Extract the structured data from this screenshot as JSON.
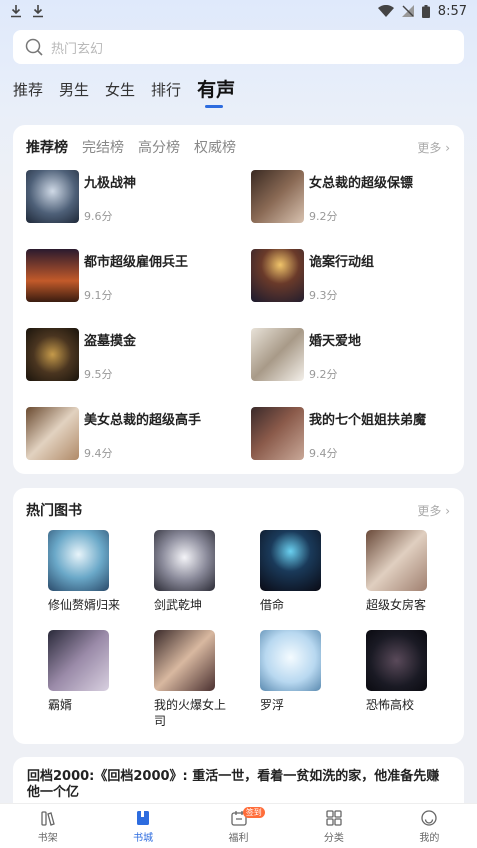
{
  "status_bar": {
    "time": "8:57"
  },
  "search": {
    "placeholder": "热门玄幻"
  },
  "nav_tabs": [
    "推荐",
    "男生",
    "女生",
    "排行",
    "有声"
  ],
  "ranking": {
    "tabs": [
      "推荐榜",
      "完结榜",
      "高分榜",
      "权威榜"
    ],
    "more": "更多",
    "items": [
      {
        "title": "九极战神",
        "score": "9.6分"
      },
      {
        "title": "女总裁的超级保镖",
        "score": "9.2分"
      },
      {
        "title": "都市超级雇佣兵王",
        "score": "9.1分"
      },
      {
        "title": "诡案行动组",
        "score": "9.3分"
      },
      {
        "title": "盗墓摸金",
        "score": "9.5分"
      },
      {
        "title": "婚天爱地",
        "score": "9.2分"
      },
      {
        "title": "美女总裁的超级高手",
        "score": "9.4分"
      },
      {
        "title": "我的七个姐姐扶弟魔",
        "score": "9.4分"
      }
    ]
  },
  "hot_books": {
    "title": "热门图书",
    "more": "更多",
    "items": [
      {
        "title": "修仙赘婿归来"
      },
      {
        "title": "剑武乾坤"
      },
      {
        "title": "借命"
      },
      {
        "title": "超级女房客"
      },
      {
        "title": "霸婿"
      },
      {
        "title": "我的火爆女上司"
      },
      {
        "title": "罗浮"
      },
      {
        "title": "恐怖高校"
      }
    ]
  },
  "news": {
    "text": "回档2000:《回档2000》: 重活一世，看着一贫如洗的家，他准备先赚他一个亿"
  },
  "bottom_nav": {
    "items": [
      "书架",
      "书城",
      "福利",
      "分类",
      "我的"
    ],
    "badge": "签到"
  },
  "colors": {
    "accent": "#2d6cdf",
    "badge": "#ff6d3a"
  }
}
